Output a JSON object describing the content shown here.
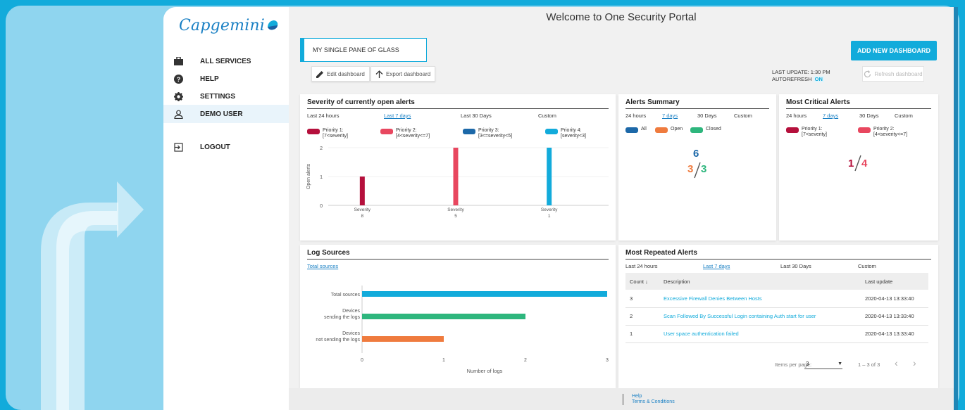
{
  "brand": {
    "logo_text": "Capgemini"
  },
  "sidebar": {
    "items": [
      {
        "label": "ALL SERVICES",
        "icon": "briefcase-icon"
      },
      {
        "label": "HELP",
        "icon": "help-icon"
      },
      {
        "label": "SETTINGS",
        "icon": "gear-icon"
      },
      {
        "label": "DEMO USER",
        "icon": "user-icon"
      },
      {
        "label": "LOGOUT",
        "icon": "logout-icon"
      }
    ]
  },
  "header": {
    "title": "Welcome to One Security Portal",
    "pane_name": "MY SINGLE PANE OF GLASS",
    "add_dashboard": "ADD NEW DASHBOARD",
    "edit_dashboard": "Edit dashboard",
    "export_dashboard": "Export dashboard",
    "last_update": "LAST UPDATE: 1:30 PM",
    "autorefresh": "AUTOREFRESH",
    "autorefresh_state": "ON",
    "refresh_dashboard": "Refresh dashboard"
  },
  "severity_card": {
    "title": "Severity of currently open alerts",
    "filters": [
      "Last 24 hours",
      "Last 7 days",
      "Last 30 Days",
      "Custom"
    ],
    "selected_filter": "Last 7 days",
    "legend": [
      {
        "line1": "Priority 1:",
        "line2": "[7<severity]",
        "color": "#b5103c"
      },
      {
        "line1": "Priority 2:",
        "line2": "[4<severity<=7]",
        "color": "#e8475f"
      },
      {
        "line1": "Priority 3:",
        "line2": "[3<=severity<5]",
        "color": "#1c68a8"
      },
      {
        "line1": "Priority 4:",
        "line2": "[severity<3]",
        "color": "#12abdb"
      }
    ]
  },
  "alerts_summary": {
    "title": "Alerts Summary",
    "filters": [
      "24 hours",
      "7 days",
      "30 Days",
      "Custom"
    ],
    "selected_filter": "7 days",
    "legend": [
      {
        "label": "All",
        "color": "#1c68a8"
      },
      {
        "label": "Open",
        "color": "#ef7b3e"
      },
      {
        "label": "Closed",
        "color": "#2eb67d"
      }
    ],
    "all_count": "6",
    "open_count": "3",
    "closed_count": "3"
  },
  "critical_alerts": {
    "title": "Most Critical Alerts",
    "filters": [
      "24 hours",
      "7 days",
      "30 Days",
      "Custom"
    ],
    "selected_filter": "7 days",
    "legend": [
      {
        "line1": "Priority 1:",
        "line2": "[7<severity]",
        "color": "#b5103c"
      },
      {
        "line1": "Priority 2:",
        "line2": "[4<severity<=7]",
        "color": "#e8475f"
      }
    ],
    "p1_count": "1",
    "p2_count": "4"
  },
  "log_sources": {
    "title": "Log Sources",
    "tab": "Total sources"
  },
  "repeated_alerts": {
    "title": "Most Repeated Alerts",
    "filters": [
      "Last 24 hours",
      "Last 7 days",
      "Last 30 Days",
      "Custom"
    ],
    "selected_filter": "Last 7 days",
    "columns": [
      "Count",
      "Description",
      "Last update"
    ],
    "rows": [
      {
        "count": "3",
        "description": "Excessive Firewall Denies Between Hosts",
        "last_update": "2020-04-13 13:33:40"
      },
      {
        "count": "2",
        "description": "Scan Followed By Successful Login containing Auth start for user",
        "last_update": "2020-04-13 13:33:40"
      },
      {
        "count": "1",
        "description": "User space authentication failed",
        "last_update": "2020-04-13 13:33:40"
      }
    ],
    "items_per_page_label": "Items per page:",
    "items_per_page": "3",
    "range": "1 – 3 of 3"
  },
  "footer": {
    "help": "Help",
    "terms": "Terms & Conditions"
  },
  "chart_data": [
    {
      "type": "bar",
      "title": "Severity of currently open alerts",
      "ylabel": "Open alerts",
      "categories": [
        "Severity\n8",
        "Severity\n5",
        "Severity\n1"
      ],
      "series": [
        {
          "name": "Priority 1: [7<severity]",
          "values": [
            1,
            0,
            0
          ],
          "color": "#b5103c"
        },
        {
          "name": "Priority 2: [4<severity<=7]",
          "values": [
            0,
            2,
            0
          ],
          "color": "#e8475f"
        },
        {
          "name": "Priority 4: [severity<3]",
          "values": [
            0,
            0,
            2
          ],
          "color": "#12abdb"
        }
      ],
      "ylim": [
        0,
        2
      ],
      "yticks": [
        0,
        1,
        2
      ]
    },
    {
      "type": "bar",
      "orientation": "horizontal",
      "title": "Log Sources",
      "xlabel": "Number of logs",
      "categories": [
        "Total sources",
        "Devices\nsending the logs",
        "Devices\nnot sending the logs"
      ],
      "values": [
        3,
        2,
        1
      ],
      "colors": [
        "#12abdb",
        "#2eb67d",
        "#ef7b3e"
      ],
      "xlim": [
        0,
        3
      ],
      "xticks": [
        0,
        1,
        2,
        3
      ]
    }
  ]
}
